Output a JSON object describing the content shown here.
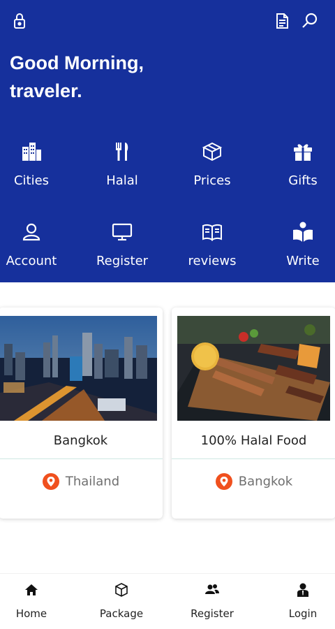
{
  "header": {
    "lock_icon": "lock-icon",
    "document_icon": "document-icon",
    "search_icon": "search-icon",
    "greeting_line1": "Good Morning,",
    "greeting_line2": "traveler."
  },
  "grid": [
    {
      "label": "Cities",
      "icon": "city-buildings-icon"
    },
    {
      "label": "Halal",
      "icon": "fork-knife-icon"
    },
    {
      "label": "Prices",
      "icon": "box-icon"
    },
    {
      "label": "Gifts",
      "icon": "gift-icon"
    },
    {
      "label": "Account",
      "icon": "user-icon"
    },
    {
      "label": "Register",
      "icon": "monitor-icon"
    },
    {
      "label": "reviews",
      "icon": "open-book-icon"
    },
    {
      "label": "Write",
      "icon": "reader-icon"
    }
  ],
  "cards": [
    {
      "title": "Bangkok",
      "location": "Thailand",
      "image": "bangkok-city-night-photo"
    },
    {
      "title": "100% Halal Food",
      "location": "Bangkok",
      "image": "grilled-food-platter-photo"
    }
  ],
  "bottom_nav": [
    {
      "label": "Home",
      "icon": "home-icon"
    },
    {
      "label": "Package",
      "icon": "package-icon"
    },
    {
      "label": "Register",
      "icon": "users-icon"
    },
    {
      "label": "Login",
      "icon": "user-icon"
    }
  ],
  "colors": {
    "primary": "#16309c",
    "pin": "#f0501e",
    "text_muted": "#6f6f6f",
    "divider": "#cfe7e2"
  }
}
